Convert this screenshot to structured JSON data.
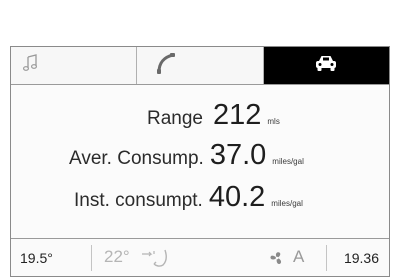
{
  "tabs": [
    {
      "icon": "music-note-icon",
      "active": false
    },
    {
      "icon": "phone-handset-icon",
      "active": false
    },
    {
      "icon": "car-icon",
      "active": true
    }
  ],
  "trip": {
    "range_label": "Range",
    "range_value": "212",
    "range_unit": "mls",
    "aver_label": "Aver. Consump.",
    "aver_value": "37.0",
    "aver_unit": "miles/gal",
    "inst_label": "Inst. consumpt.",
    "inst_value": "40.2",
    "inst_unit": "miles/gal"
  },
  "status": {
    "temp_left": "19.5°",
    "temp_mid": "22°",
    "fan_mode": "A",
    "clock": "19.36"
  },
  "colors": {
    "active_tab": "#000000",
    "text": "#2a2a2a",
    "dim": "#b5b5b5"
  }
}
